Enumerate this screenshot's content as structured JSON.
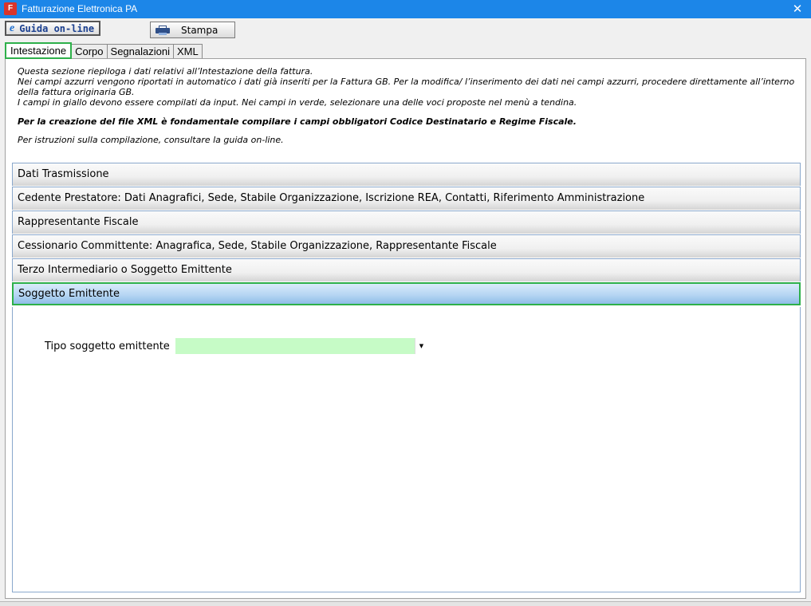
{
  "window": {
    "title": "Fatturazione Elettronica PA",
    "close_glyph": "✕"
  },
  "toolbar": {
    "guide_label": "Guida on-line",
    "print_label": "Stampa"
  },
  "tabs": [
    {
      "label": "Intestazione",
      "active": true
    },
    {
      "label": "Corpo",
      "active": false
    },
    {
      "label": "Segnalazioni",
      "active": false
    },
    {
      "label": "XML",
      "active": false
    }
  ],
  "intro": {
    "line1": "Questa sezione riepiloga i dati relativi all’Intestazione della fattura.",
    "line2": "Nei campi azzurri vengono riportati in automatico i dati già inseriti per la Fattura GB. Per la modifica/ l’inserimento dei dati nei campi azzurri, procedere direttamente all’interno della fattura originaria GB.",
    "line3": "I campi in giallo devono essere compilati da input. Nei campi in verde, selezionare una delle voci proposte nel menù a tendina.",
    "bold": "Per la creazione del file XML è fondamentale compilare i campi obbligatori Codice Destinatario e Regime Fiscale.",
    "note": "Per istruzioni sulla compilazione, consultare la guida on-line."
  },
  "sections": [
    {
      "label": "Dati Trasmissione"
    },
    {
      "label": "Cedente Prestatore: Dati Anagrafici, Sede, Stabile Organizzazione, Iscrizione REA, Contatti, Riferimento Amministrazione"
    },
    {
      "label": "Rappresentante Fiscale"
    },
    {
      "label": "Cessionario Committente: Anagrafica, Sede, Stabile Organizzazione, Rappresentante Fiscale"
    },
    {
      "label": "Terzo Intermediario o Soggetto Emittente"
    },
    {
      "label": "Soggetto Emittente"
    }
  ],
  "form": {
    "tipo_label": "Tipo soggetto emittente",
    "tipo_value": ""
  },
  "colors": {
    "titlebar": "#1c86e8",
    "highlight": "#2eb04a",
    "select_fill": "#c6fbc6",
    "active_section": "#b6d6f3"
  }
}
